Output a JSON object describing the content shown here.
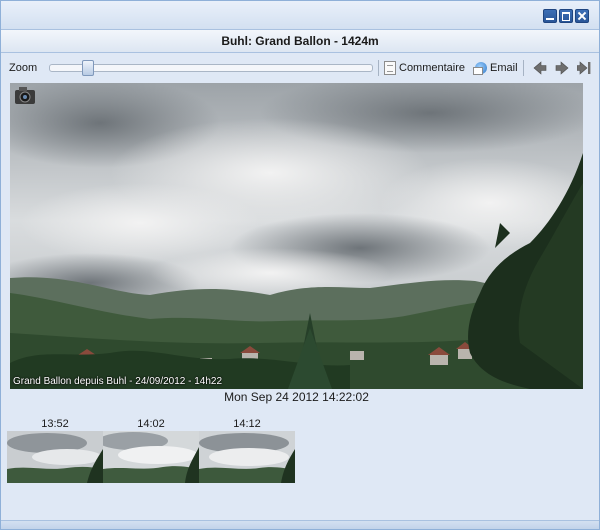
{
  "window": {
    "controls": [
      "minimize-icon",
      "maximize-icon",
      "close-icon"
    ]
  },
  "panel": {
    "title": "Buhl: Grand Ballon - 1424m"
  },
  "toolbar": {
    "zoom_label": "Zoom",
    "zoom_level": 0.05,
    "comment_label": "Commentaire",
    "email_label": "Email",
    "nav_icons": [
      "arrow-left-icon",
      "arrow-right-icon",
      "arrow-last-icon"
    ]
  },
  "photo": {
    "caption": "Grand Ballon depuis Buhl - 24/09/2012 - 14h22",
    "timestamp": "Mon Sep 24 2012 14:22:02"
  },
  "thumbnails": [
    {
      "time": "13:52"
    },
    {
      "time": "14:02"
    },
    {
      "time": "14:12"
    }
  ],
  "colors": {
    "window_bg": "#dfe8f5",
    "accent": "#2a5698",
    "border": "#8fb0d8"
  }
}
